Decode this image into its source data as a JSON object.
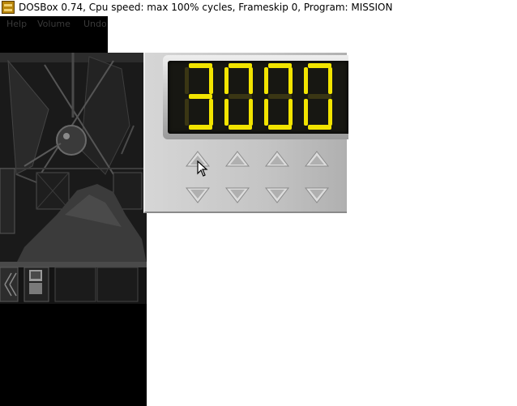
{
  "window": {
    "title": "DOSBox 0.74, Cpu speed: max 100% cycles, Frameskip  0, Program:  MISSION",
    "icon": "dosbox-app-icon"
  },
  "menu": {
    "items": [
      {
        "label": "Help"
      },
      {
        "label": "Volume"
      },
      {
        "label": "Undo"
      }
    ]
  },
  "keypad": {
    "digits": [
      "3",
      "0",
      "0",
      "0"
    ],
    "segment_on_color": "#f2e400",
    "segment_off_color": "#3a3614",
    "increment_icon": "up-triangle-icon",
    "decrement_icon": "down-triangle-icon"
  }
}
